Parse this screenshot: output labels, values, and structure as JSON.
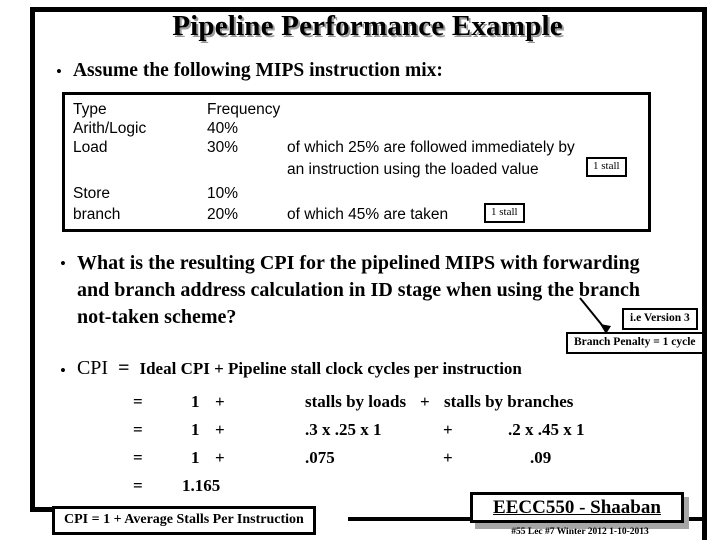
{
  "slide": {
    "title": "Pipeline Performance Example"
  },
  "bullets": {
    "assume": "Assume the following MIPS instruction mix:",
    "question": "What is the resulting CPI for the pipelined MIPS with forwarding and branch address calculation in ID stage when using the branch not-taken scheme?",
    "cpi_lead": "CPI",
    "cpi_equals": "=",
    "cpi_rest": "Ideal CPI + Pipeline stall clock cycles per instruction"
  },
  "mix_table": {
    "headers": {
      "type": "Type",
      "frequency": "Frequency"
    },
    "rows": [
      {
        "type": "Arith/Logic",
        "frequency": "40%",
        "note": "",
        "note2": ""
      },
      {
        "type": "Load",
        "frequency": "30%",
        "note": "of which 25% are followed immediately by",
        "note2": "an instruction using the loaded value"
      },
      {
        "type": "Store",
        "frequency": "10%",
        "note": "",
        "note2": ""
      },
      {
        "type": "branch",
        "frequency": "20%",
        "note": "of which 45% are taken",
        "note2": ""
      }
    ],
    "stall_load": "1 stall",
    "stall_branch": "1 stall"
  },
  "callouts": {
    "version": "i.e Version 3",
    "branch_penalty": "Branch Penalty = 1 cycle"
  },
  "equation_rows": [
    {
      "eq": "=",
      "one": "1",
      "plus1": "+",
      "mid": "stalls by loads",
      "plus2": "+",
      "right": "stalls by branches"
    },
    {
      "eq": "=",
      "one": "1",
      "plus1": "+",
      "mid": ".3 x .25 x 1",
      "plus2": "+",
      "right": ".2 x .45 x 1"
    },
    {
      "eq": "=",
      "one": "1",
      "plus1": "+",
      "mid": ".075",
      "plus2": "+",
      "right": ".09"
    },
    {
      "eq": "=",
      "one": "1.165",
      "plus1": "",
      "mid": "",
      "plus2": "",
      "right": ""
    }
  ],
  "footer": {
    "cpi_formula": "CPI = 1 + Average Stalls Per Instruction",
    "course": "EECC550 - Shaaban",
    "meta": "#55   Lec #7  Winter 2012  1-10-2013"
  }
}
